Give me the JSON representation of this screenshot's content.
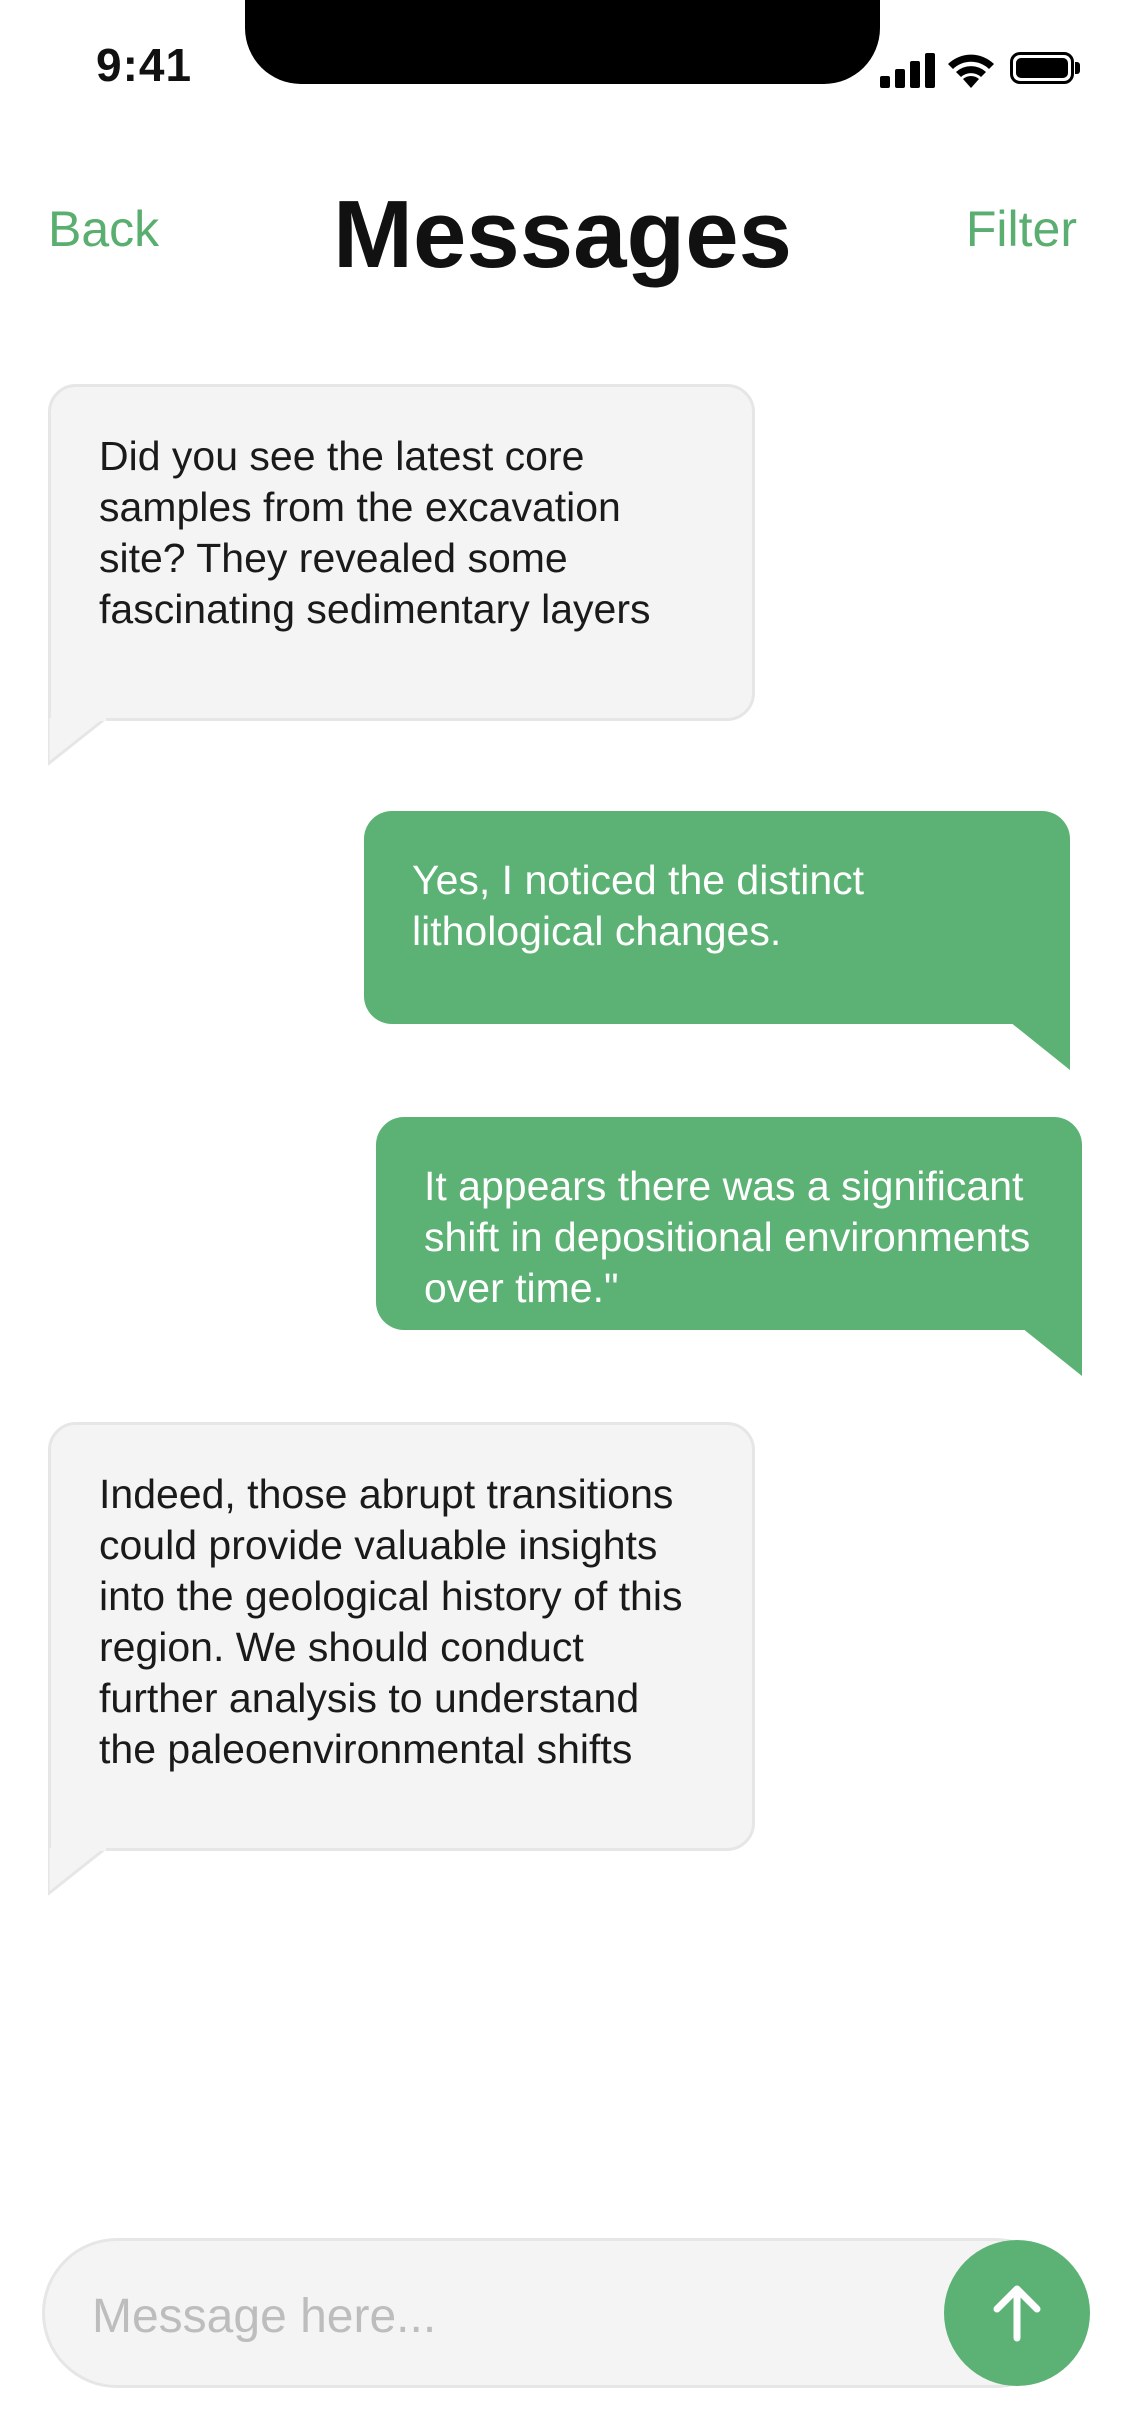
{
  "status_bar": {
    "time": "9:41"
  },
  "header": {
    "back_label": "Back",
    "title": "Messages",
    "filter_label": "Filter"
  },
  "messages": [
    {
      "direction": "incoming",
      "text": "Did you see the latest core samples from the excavation site? They revealed some fascinating sedimentary layers"
    },
    {
      "direction": "outgoing",
      "text": "Yes, I noticed the distinct lithological changes."
    },
    {
      "direction": "outgoing",
      "text": "It appears there was a significant shift in depositional environments over time.\""
    },
    {
      "direction": "incoming",
      "text": "Indeed, those abrupt transitions could provide valuable insights into the geological history of this region. We should conduct further analysis to understand the paleoenvironmental shifts"
    }
  ],
  "composer": {
    "placeholder": "Message here...",
    "value": ""
  },
  "colors": {
    "accent": "#5cb274",
    "incoming_bg": "#f4f4f4",
    "incoming_border": "#e6e6e6"
  },
  "icons": {
    "send": "arrow-up-icon",
    "signal": "cellular-signal-icon",
    "wifi": "wifi-icon",
    "battery": "battery-icon"
  }
}
